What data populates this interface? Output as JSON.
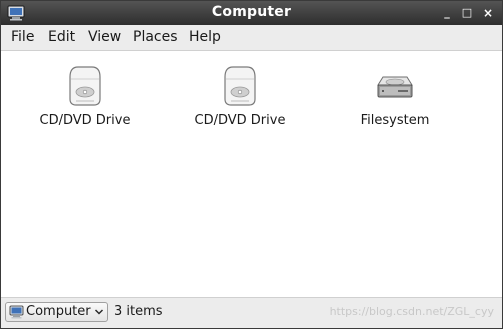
{
  "window": {
    "title": "Computer",
    "controls": {
      "minimize": "_",
      "maximize": "□",
      "close": "×"
    }
  },
  "menubar": {
    "items": [
      {
        "label": "File"
      },
      {
        "label": "Edit"
      },
      {
        "label": "View"
      },
      {
        "label": "Places"
      },
      {
        "label": "Help"
      }
    ]
  },
  "content": {
    "items": [
      {
        "label": "CD/DVD Drive",
        "icon": "cd-dvd-drive-icon"
      },
      {
        "label": "CD/DVD Drive",
        "icon": "cd-dvd-drive-icon"
      },
      {
        "label": "Filesystem",
        "icon": "hard-disk-icon"
      }
    ]
  },
  "statusbar": {
    "location": "Computer",
    "location_icon": "computer-icon",
    "item_count": "3 items",
    "watermark": "https://blog.csdn.net/ZGL_cyy"
  },
  "colors": {
    "titlebar": "#3a3a3a",
    "menubar": "#ececec",
    "content_bg": "#ffffff"
  }
}
